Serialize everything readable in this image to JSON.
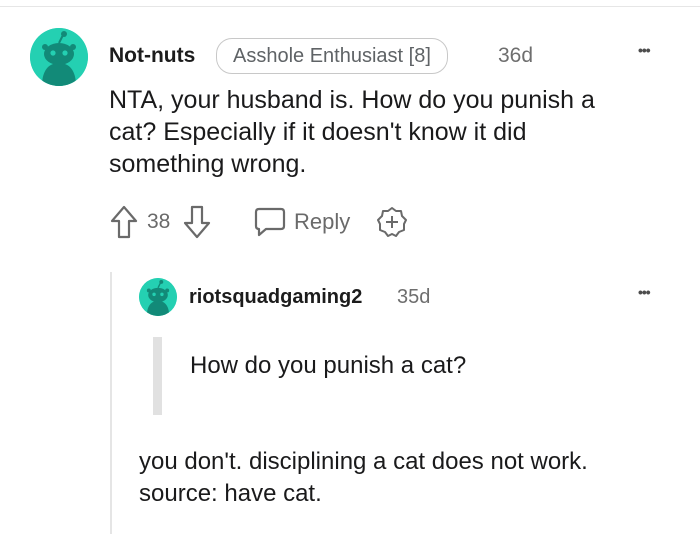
{
  "comment": {
    "username": "Not-nuts",
    "flair": "Asshole Enthusiast [8]",
    "age": "36d",
    "more": "•••",
    "body_lines": [
      "NTA, your husband is. How do you punish a",
      "cat? Especially if it doesn't know it did",
      "something wrong."
    ],
    "score": "38",
    "reply_label": "Reply",
    "icons": [
      "upvote-icon",
      "downvote-icon",
      "reply-icon",
      "award-icon",
      "more-icon"
    ]
  },
  "reply": {
    "username": "riotsquadgaming2",
    "age": "35d",
    "more": "•••",
    "quote": "How do you punish a cat?",
    "body_lines": [
      "you don't. disciplining a cat does not work.",
      "source: have cat."
    ]
  },
  "colors": {
    "avatar": "#24d0b2",
    "text": "#1a1a1b",
    "meta": "#6e6e6e"
  }
}
